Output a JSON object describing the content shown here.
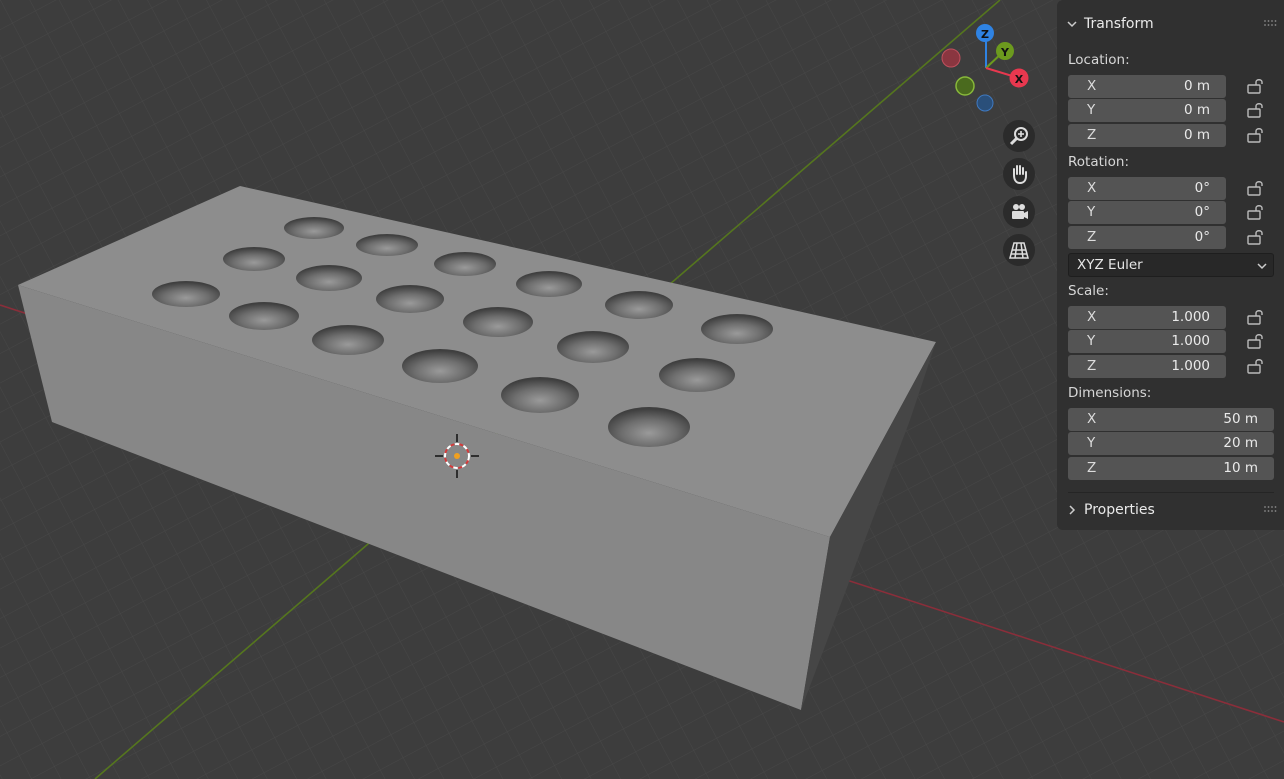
{
  "gizmo": {
    "x_label": "X",
    "y_label": "Y",
    "z_label": "Z"
  },
  "nav_buttons": [
    "zoom-icon",
    "hand-pan-icon",
    "camera-icon",
    "grid-perspective-icon"
  ],
  "transform": {
    "title": "Transform",
    "location_label": "Location:",
    "location": [
      {
        "axis": "X",
        "value": "0 m"
      },
      {
        "axis": "Y",
        "value": "0 m"
      },
      {
        "axis": "Z",
        "value": "0 m"
      }
    ],
    "rotation_label": "Rotation:",
    "rotation": [
      {
        "axis": "X",
        "value": "0°"
      },
      {
        "axis": "Y",
        "value": "0°"
      },
      {
        "axis": "Z",
        "value": "0°"
      }
    ],
    "rotation_mode": "XYZ Euler",
    "scale_label": "Scale:",
    "scale": [
      {
        "axis": "X",
        "value": "1.000"
      },
      {
        "axis": "Y",
        "value": "1.000"
      },
      {
        "axis": "Z",
        "value": "1.000"
      }
    ],
    "dimensions_label": "Dimensions:",
    "dimensions": [
      {
        "axis": "X",
        "value": "50 m"
      },
      {
        "axis": "Y",
        "value": "20 m"
      },
      {
        "axis": "Z",
        "value": "10 m"
      }
    ]
  },
  "properties": {
    "title": "Properties"
  },
  "colors": {
    "x_axis": "#e8384f",
    "y_axis": "#6c9a1e",
    "z_axis": "#2f83e3",
    "background": "#3d3d3d",
    "panel": "#303030",
    "field": "#545454"
  }
}
